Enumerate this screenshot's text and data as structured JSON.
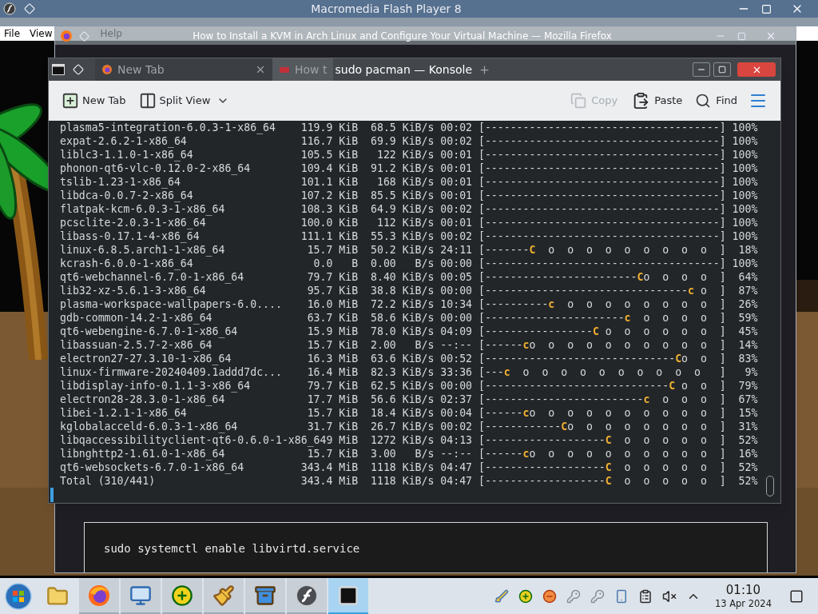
{
  "flash_window": {
    "title": "Macromedia Flash Player 8",
    "menu": [
      "File",
      "View",
      "Help"
    ]
  },
  "browser_window": {
    "title": "How to Install a KVM in Arch Linux and Configure Your Virtual Machine — Mozilla Firefox",
    "code": "sudo systemctl enable libvirtd.service"
  },
  "konsole": {
    "title": "sudo pacman — Konsole",
    "tabs": [
      {
        "label": "New Tab",
        "selected": false
      },
      {
        "label": "How t",
        "selected": true
      }
    ],
    "toolbar": {
      "new_tab": "New Tab",
      "split_view": "Split View",
      "copy": {
        "label": "Copy",
        "disabled": true
      },
      "paste": "Paste",
      "find": "Find"
    },
    "rows": [
      {
        "name": "plasma5-integration-6.0.3-1-x86_64",
        "size": "119.9 KiB",
        "speed": "68.5 KiB/s",
        "eta": "00:02",
        "bar": {
          "left": "[-------------------------------------]"
        },
        "percent": "100%"
      },
      {
        "name": "expat-2.6.2-1-x86_64",
        "size": "116.7 KiB",
        "speed": "69.9 KiB/s",
        "eta": "00:02",
        "bar": {
          "left": "[-------------------------------------]"
        },
        "percent": "100%"
      },
      {
        "name": "liblc3-1.1.0-1-x86_64",
        "size": "105.5 KiB",
        "speed": "122 KiB/s",
        "eta": "00:01",
        "bar": {
          "left": "[-------------------------------------]"
        },
        "percent": "100%"
      },
      {
        "name": "phonon-qt6-vlc-0.12.0-2-x86_64",
        "size": "109.4 KiB",
        "speed": "91.2 KiB/s",
        "eta": "00:01",
        "bar": {
          "left": "[-------------------------------------]"
        },
        "percent": "100%"
      },
      {
        "name": "tslib-1.23-1-x86_64",
        "size": "101.1 KiB",
        "speed": "168 KiB/s",
        "eta": "00:01",
        "bar": {
          "left": "[-------------------------------------]"
        },
        "percent": "100%"
      },
      {
        "name": "libdca-0.0.7-2-x86_64",
        "size": "107.2 KiB",
        "speed": "85.5 KiB/s",
        "eta": "00:01",
        "bar": {
          "left": "[-------------------------------------]"
        },
        "percent": "100%"
      },
      {
        "name": "flatpak-kcm-6.0.3-1-x86_64",
        "size": "108.3 KiB",
        "speed": "64.9 KiB/s",
        "eta": "00:02",
        "bar": {
          "left": "[-------------------------------------]"
        },
        "percent": "100%"
      },
      {
        "name": "pcsclite-2.0.3-1-x86_64",
        "size": "100.0 KiB",
        "speed": "112 KiB/s",
        "eta": "00:01",
        "bar": {
          "left": "[-------------------------------------]"
        },
        "percent": "100%"
      },
      {
        "name": "libass-0.17.1-4-x86_64",
        "size": "111.1 KiB",
        "speed": "55.3 KiB/s",
        "eta": "00:02",
        "bar": {
          "left": "[-------------------------------------]"
        },
        "percent": "100%"
      },
      {
        "name": "linux-6.8.5.arch1-1-x86_64",
        "size": "15.7 MiB",
        "speed": "50.2 KiB/s",
        "eta": "24:11",
        "bar": {
          "left": "[-------",
          "pac": "C",
          "right": "  o  o  o  o  o  o  o  o  o  ]"
        },
        "percent": "18%"
      },
      {
        "name": "kcrash-6.0.0-1-x86_64",
        "size": "0.0   B",
        "speed": "0.00   B/s",
        "eta": "00:00",
        "bar": {
          "left": "[-------------------------------------]"
        },
        "percent": "100%"
      },
      {
        "name": "qt6-webchannel-6.7.0-1-x86_64",
        "size": "79.7 KiB",
        "speed": "8.40 KiB/s",
        "eta": "00:05",
        "bar": {
          "left": "[------------------------",
          "pac": "C",
          "right": "o  o  o  o  ]"
        },
        "percent": "64%"
      },
      {
        "name": "lib32-xz-5.6.1-3-x86_64",
        "size": "95.7 KiB",
        "speed": "38.8 KiB/s",
        "eta": "00:00",
        "bar": {
          "left": "[--------------------------------",
          "pac": "c",
          "right": " o  ]"
        },
        "percent": "87%"
      },
      {
        "name": "plasma-workspace-wallpapers-6.0....",
        "size": "16.0 MiB",
        "speed": "72.2 KiB/s",
        "eta": "10:34",
        "bar": {
          "left": "[----------",
          "pac": "c",
          "right": "  o  o  o  o  o  o  o  o  ]"
        },
        "percent": "26%"
      },
      {
        "name": "gdb-common-14.2-1-x86_64",
        "size": "63.7 KiB",
        "speed": "58.6 KiB/s",
        "eta": "00:00",
        "bar": {
          "left": "[----------------------",
          "pac": "c",
          "right": "  o  o  o  o  ]"
        },
        "percent": "59%"
      },
      {
        "name": "qt6-webengine-6.7.0-1-x86_64",
        "size": "15.9 MiB",
        "speed": "78.0 KiB/s",
        "eta": "04:09",
        "bar": {
          "left": "[-----------------",
          "pac": "C",
          "right": " o  o  o  o  o  o  ]"
        },
        "percent": "45%"
      },
      {
        "name": "libassuan-2.5.7-2-x86_64",
        "size": "15.7 KiB",
        "speed": "2.00   B/s",
        "eta": "--:--",
        "bar": {
          "left": "[------",
          "pac": "c",
          "right": "o  o  o  o  o  o  o  o  o  o  ]"
        },
        "percent": "14%"
      },
      {
        "name": "electron27-27.3.10-1-x86_64",
        "size": "16.3 MiB",
        "speed": "63.6 KiB/s",
        "eta": "00:52",
        "bar": {
          "left": "[------------------------------",
          "pac": "C",
          "right": "o  o  ]"
        },
        "percent": "83%"
      },
      {
        "name": "linux-firmware-20240409.1addd7dc...",
        "size": "16.4 MiB",
        "speed": "82.3 KiB/s",
        "eta": "33:36",
        "bar": {
          "left": "[---",
          "pac": "c",
          "right": "  o  o  o  o  o  o  o  o  o  o   ]"
        },
        "percent": "9%"
      },
      {
        "name": "libdisplay-info-0.1.1-3-x86_64",
        "size": "79.7 KiB",
        "speed": "62.5 KiB/s",
        "eta": "00:00",
        "bar": {
          "left": "[-----------------------------",
          "pac": "C",
          "right": " o  o  ]"
        },
        "percent": "79%"
      },
      {
        "name": "electron28-28.3.0-1-x86_64",
        "size": "17.7 MiB",
        "speed": "56.6 KiB/s",
        "eta": "02:37",
        "bar": {
          "left": "[-------------------------",
          "pac": "c",
          "right": "  o  o  o  ]"
        },
        "percent": "67%"
      },
      {
        "name": "libei-1.2.1-1-x86_64",
        "size": "15.7 KiB",
        "speed": "18.4 KiB/s",
        "eta": "00:04",
        "bar": {
          "left": "[------",
          "pac": "c",
          "right": "o  o  o  o  o  o  o  o  o  o  ]"
        },
        "percent": "15%"
      },
      {
        "name": "kglobalacceld-6.0.3-1-x86_64",
        "size": "31.7 KiB",
        "speed": "26.7 KiB/s",
        "eta": "00:02",
        "bar": {
          "left": "[------------",
          "pac": "C",
          "right": "o  o  o  o  o  o  o  o  ]"
        },
        "percent": "31%"
      },
      {
        "name": "libqaccessibilityclient-qt6-0.6.0-1-x86_649",
        "size": "MiB",
        "speed": "1272 KiB/s",
        "eta": "04:13",
        "bar": {
          "left": "[-------------------",
          "pac": "C",
          "right": "  o  o  o  o  o  ]"
        },
        "percent": "52%"
      },
      {
        "name": "libnghttp2-1.61.0-1-x86_64",
        "size": "15.7 KiB",
        "speed": "3.00   B/s",
        "eta": "--:--",
        "bar": {
          "left": "[------",
          "pac": "c",
          "right": "o  o  o  o  o  o  o  o  o  o  ]"
        },
        "percent": "16%"
      },
      {
        "name": "qt6-websockets-6.7.0-1-x86_64",
        "size": "343.4 MiB",
        "speed": "1118 KiB/s",
        "eta": "04:47",
        "bar": {
          "left": "[-------------------",
          "pac": "C",
          "right": "  o  o  o  o  o  ]"
        },
        "percent": "52%"
      },
      {
        "name": "Total (310/441)",
        "size": "343.4 MiB",
        "speed": "1118 KiB/s",
        "eta": "04:47",
        "bar": {
          "left": "[-------------------",
          "pac": "C",
          "right": "  o  o  o  o  o  ]"
        },
        "percent": "52%"
      }
    ]
  },
  "taskbar": {
    "apps": [
      {
        "kind": "folder",
        "open": false,
        "selected": false
      },
      {
        "kind": "browser",
        "open": true,
        "selected": false
      },
      {
        "kind": "monitor",
        "open": true,
        "selected": false
      },
      {
        "kind": "plus",
        "open": true,
        "selected": false
      },
      {
        "kind": "brush",
        "open": true,
        "selected": false
      },
      {
        "kind": "archive",
        "open": true,
        "selected": false
      },
      {
        "kind": "flash",
        "open": true,
        "selected": false
      },
      {
        "kind": "terminal",
        "open": true,
        "selected": true
      }
    ],
    "clock": {
      "time": "01:10",
      "date": "13 Apr 2024"
    }
  }
}
